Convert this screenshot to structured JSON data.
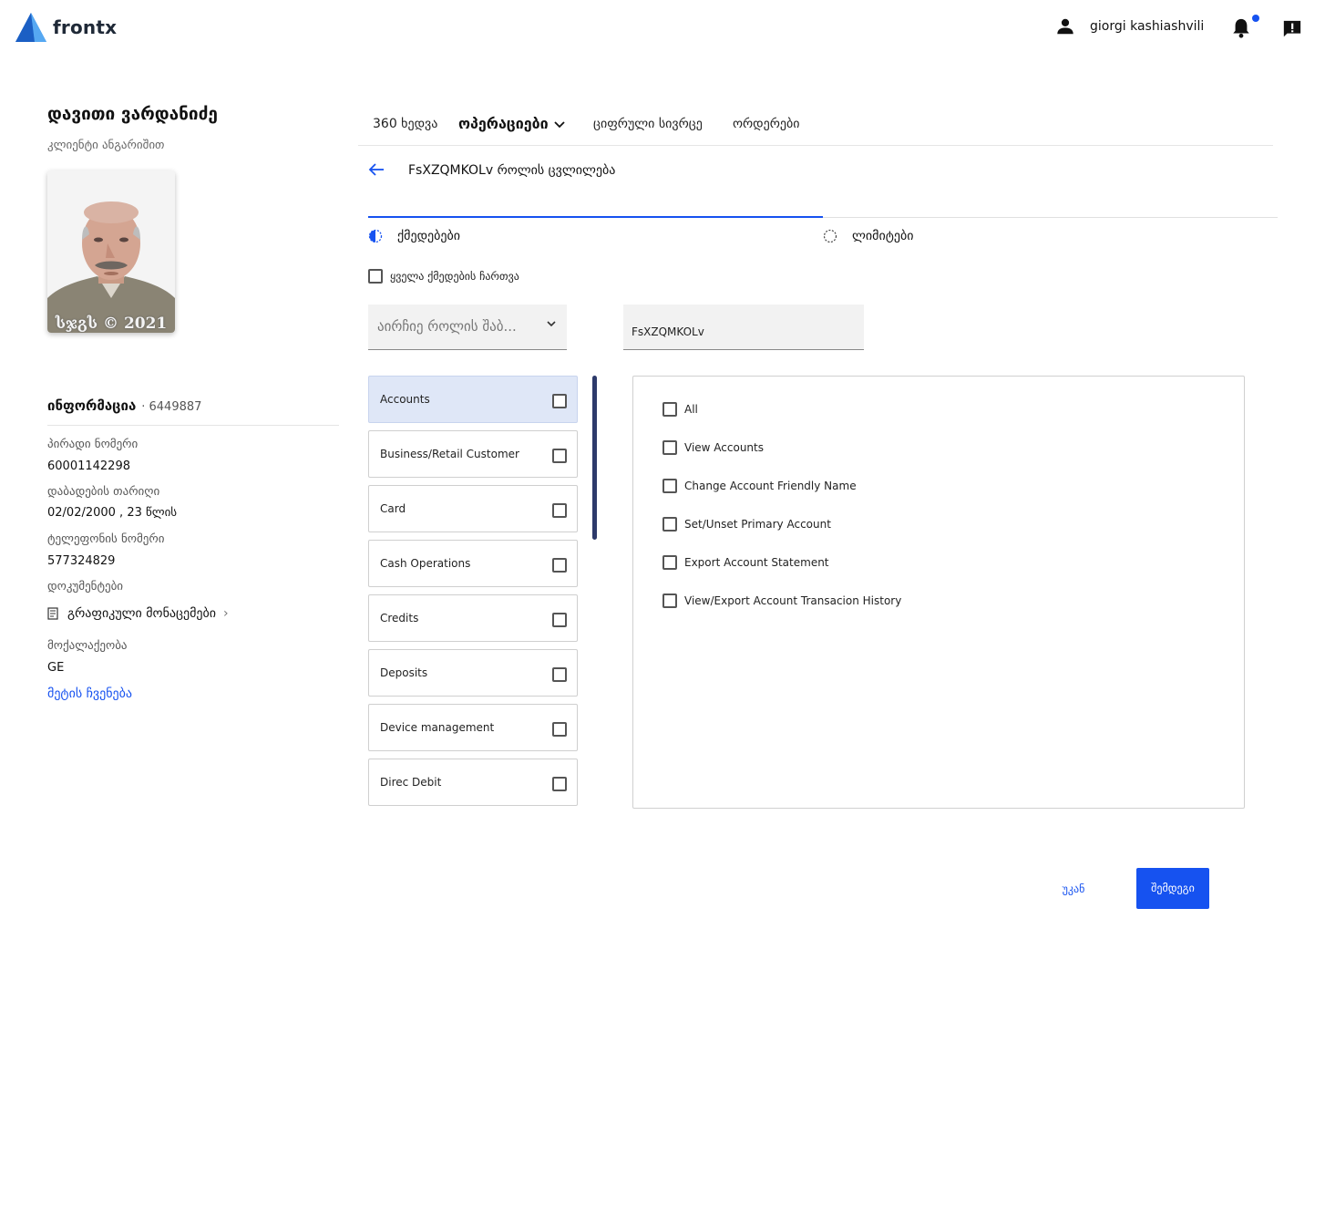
{
  "header": {
    "app_name": "frontx",
    "user_name": "giorgi kashiashvili",
    "icons": [
      "user-icon",
      "bell-icon",
      "feedback-icon"
    ],
    "accent_color": "#1652f0"
  },
  "client": {
    "name": "დავითი ვარდანიძე",
    "subtitle": "კლიენტი ანგარიშით",
    "photo_caption": "სჯგს © 2021"
  },
  "info": {
    "title": "ინფორმაცია",
    "id": "6449887",
    "personal_number_label": "პირადი ნომერი",
    "personal_number": "60001142298",
    "birth_date_label": "დაბადების თარიღი",
    "birth_date": "02/02/2000 , 23 წლის",
    "phone_label": "ტელეფონის ნომერი",
    "phone": "577324829",
    "documents_label": "დოკუმენტები",
    "documents_link": "გრაფიკული მონაცემები",
    "citizenship_label": "მოქალაქეობა",
    "citizenship": "GE",
    "show_more": "მეტის ჩვენება"
  },
  "tabs": [
    {
      "label": "360 ხედვა"
    },
    {
      "label": "ოპერაციები"
    },
    {
      "label": "ციფრული სივრცე"
    },
    {
      "label": "ორდერები"
    }
  ],
  "page": {
    "title": "FsXZQMKOLv როლის ცვლილება"
  },
  "steps": [
    {
      "label": "ქმედებები",
      "state": "in-progress"
    },
    {
      "label": "ლიმიტები",
      "state": "pending"
    }
  ],
  "select_all_label": "ყველა ქმედების ჩართვა",
  "role_select": {
    "placeholder": "აირჩიე როლის შაბ..."
  },
  "role_name": {
    "value": "FsXZQMKOLv"
  },
  "categories": [
    {
      "label": "Accounts",
      "active": true
    },
    {
      "label": "Business/Retail Customer"
    },
    {
      "label": "Card"
    },
    {
      "label": "Cash Operations"
    },
    {
      "label": "Credits"
    },
    {
      "label": "Deposits"
    },
    {
      "label": "Device management"
    },
    {
      "label": "Direc Debit"
    }
  ],
  "permissions": [
    {
      "label": "All"
    },
    {
      "label": "View Accounts"
    },
    {
      "label": "Change Account Friendly Name"
    },
    {
      "label": "Set/Unset Primary Account"
    },
    {
      "label": "Export Account Statement"
    },
    {
      "label": "View/Export Account Transacion History"
    }
  ],
  "buttons": {
    "back": "უკან",
    "next": "შემდეგი"
  }
}
